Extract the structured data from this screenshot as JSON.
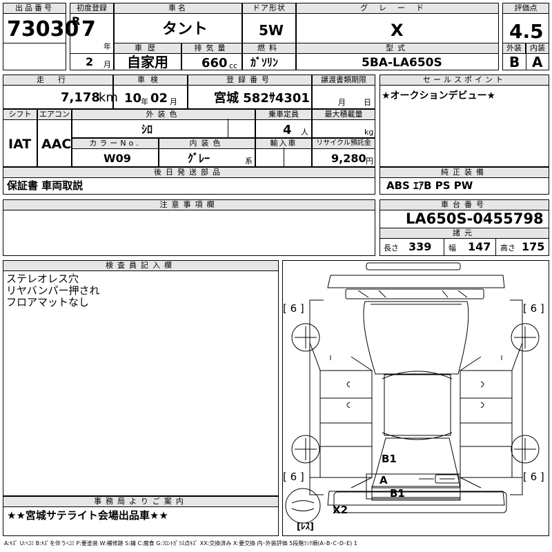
{
  "labels": {
    "lot_no": "出品番号",
    "first_reg": "初度登録",
    "car_name": "車名",
    "door": "ドア形状",
    "grade": "グレード",
    "score": "評価点",
    "history": "車歴",
    "displacement": "排気量",
    "fuel": "燃料",
    "model": "型式",
    "exterior": "外装",
    "interior": "内装",
    "mileage": "走行",
    "inspection": "車検",
    "plate": "登録番号",
    "transfer": "譲渡書類期限",
    "sales_point": "セールスポイント",
    "shift": "シフト",
    "aircon": "エアコン",
    "ext_color": "外装色",
    "capacity": "乗車定員",
    "max_load": "最大積載量",
    "color_no": "カラーNo.",
    "int_color": "内装色",
    "import": "輸入車",
    "recycle": "リサイクル預託金",
    "later_parts": "後日発送部品",
    "genuine": "純正装備",
    "notes": "注意事項欄",
    "chassis": "車台番号",
    "specs": "諸元",
    "inspector": "検査員記入欄",
    "office": "事務局よりご案内"
  },
  "units": {
    "year": "年",
    "month": "月",
    "cc": "cc",
    "km": "km",
    "people": "人",
    "kg": "kg",
    "kei": "系",
    "yen": "円",
    "length": "長さ",
    "width": "幅",
    "height": "高さ"
  },
  "values": {
    "lot_no": "73030",
    "era": "R",
    "year": "7",
    "month": "2",
    "car_name": "タント",
    "door": "5W",
    "grade": "X",
    "score": "4.5",
    "history": "自家用",
    "displacement": "660",
    "fuel": "ｶﾞｿﾘﾝ",
    "model": "5BA-LA650S",
    "exterior": "B",
    "interior": "A",
    "mileage": "7,178",
    "insp_year": "10",
    "insp_month": "02",
    "plate": "宮城 582ｻ4301",
    "sales_point": "★オークションデビュー★",
    "shift": "IAT",
    "aircon": "AAC",
    "ext_color": "ｼﾛ",
    "capacity": "4",
    "color_no": "W09",
    "int_color": "ｸﾞﾚｰ",
    "recycle": "9,280",
    "later_parts": "保証書 車両取説",
    "genuine": "ABS ｴｱB PS PW",
    "chassis": "LA650S-0455798",
    "length": "339",
    "width": "147",
    "height": "175",
    "office": "★★宮城サテライト会場出品車★★"
  },
  "inspector_notes": [
    "ステレオレス穴",
    "リヤバンパー押され",
    "フロアマットなし"
  ],
  "diagram": {
    "tire_tl": "[ 6 ]",
    "tire_tr": "[ 6 ]",
    "tire_bl": "[ 6 ]",
    "tire_br": "[ 6 ]",
    "mark_b1_upper": "B1",
    "mark_a": "A",
    "mark_b1_lower": "B1",
    "mark_x2": "X2",
    "mark_less": "[ﾚｽ]"
  },
  "legend": "A:ｷｽﾞ U:ﾍｺﾐ B:ｷｽﾞを伴うﾍｺﾐ P:要塗装 W:補修跡 S:錆 C:腐食 G:ﾌﾛﾝﾄｶﾞﾗｽ点ｷｽﾞ XX:交換済み X:要交換 内･外装評価 5段階ﾗﾝｸ順(A･B･C･D･E) 1"
}
